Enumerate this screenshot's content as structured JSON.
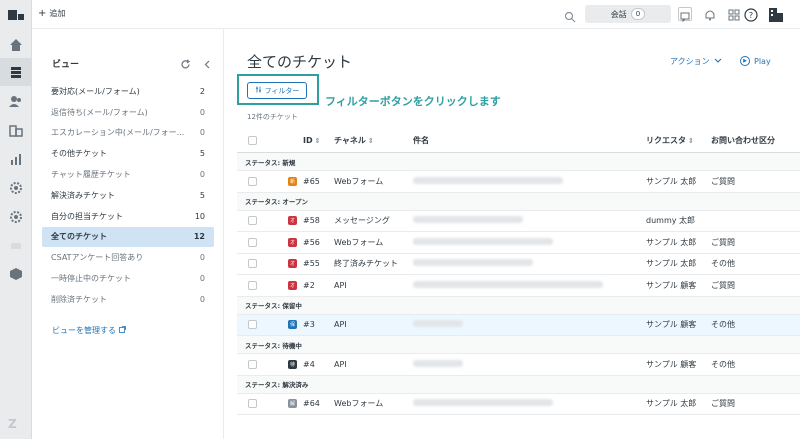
{
  "topbar": {
    "add_label": "追加",
    "conversations_label": "会話",
    "conversations_count": "0"
  },
  "views": {
    "title": "ビュー",
    "items": [
      {
        "label": "要対応(メール/フォーム)",
        "count": "2",
        "style": ""
      },
      {
        "label": "返信待ち(メール/フォーム)",
        "count": "0",
        "style": "muted"
      },
      {
        "label": "エスカレーション中(メール/フォー...",
        "count": "0",
        "style": "muted"
      },
      {
        "label": "その他チケット",
        "count": "5",
        "style": ""
      },
      {
        "label": "チャット履歴チケット",
        "count": "0",
        "style": "muted"
      },
      {
        "label": "解決済みチケット",
        "count": "5",
        "style": ""
      },
      {
        "label": "自分の担当チケット",
        "count": "10",
        "style": ""
      },
      {
        "label": "全てのチケット",
        "count": "12",
        "style": "active"
      },
      {
        "label": "CSATアンケート回答あり",
        "count": "0",
        "style": "muted"
      },
      {
        "label": "一時停止中のチケット",
        "count": "0",
        "style": "muted"
      },
      {
        "label": "削除済チケット",
        "count": "0",
        "style": "muted"
      }
    ],
    "manage_link": "ビューを管理する"
  },
  "main": {
    "title": "全てのチケット",
    "action_label": "アクション",
    "play_label": "Play",
    "filter_label": "フィルター",
    "annotation": "フィルターボタンをクリックします",
    "ticket_count": "12件のチケット",
    "columns": {
      "id": "ID",
      "channel": "チャネル",
      "subject": "件名",
      "requester": "リクエスタ",
      "category": "お問い合わせ区分"
    }
  },
  "groups": [
    {
      "label": "ステータス: 新規",
      "rows": [
        {
          "badge": "新",
          "color": "#e38215",
          "id": "#65",
          "channel": "Webフォーム",
          "requester": "サンプル 太郎",
          "category": "ご質問",
          "hl": false,
          "blur": 150
        }
      ]
    },
    {
      "label": "ステータス: オープン",
      "rows": [
        {
          "badge": "オ",
          "color": "#cc3340",
          "id": "#58",
          "channel": "メッセージング",
          "requester": "dummy 太郎",
          "category": "",
          "hl": false,
          "blur": 110
        },
        {
          "badge": "オ",
          "color": "#cc3340",
          "id": "#56",
          "channel": "Webフォーム",
          "requester": "サンプル 太郎",
          "category": "ご質問",
          "hl": false,
          "blur": 140
        },
        {
          "badge": "オ",
          "color": "#cc3340",
          "id": "#55",
          "channel": "終了済みチケット",
          "requester": "サンプル 太郎",
          "category": "その他",
          "hl": false,
          "blur": 120
        },
        {
          "badge": "オ",
          "color": "#cc3340",
          "id": "#2",
          "channel": "API",
          "requester": "サンプル 顧客",
          "category": "ご質問",
          "hl": false,
          "blur": 190
        }
      ]
    },
    {
      "label": "ステータス: 保留中",
      "rows": [
        {
          "badge": "保",
          "color": "#1f73b7",
          "id": "#3",
          "channel": "API",
          "requester": "サンプル 顧客",
          "category": "その他",
          "hl": true,
          "blur": 50
        }
      ]
    },
    {
      "label": "ステータス: 待機中",
      "rows": [
        {
          "badge": "待",
          "color": "#2f3941",
          "id": "#4",
          "channel": "API",
          "requester": "サンプル 顧客",
          "category": "その他",
          "hl": false,
          "blur": 50
        }
      ]
    },
    {
      "label": "ステータス: 解決済み",
      "rows": [
        {
          "badge": "解",
          "color": "#87929d",
          "id": "#64",
          "channel": "Webフォーム",
          "requester": "サンプル 太郎",
          "category": "ご質問",
          "hl": false,
          "blur": 140
        }
      ]
    }
  ]
}
